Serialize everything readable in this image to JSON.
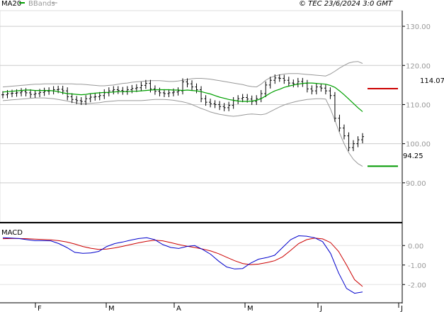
{
  "header": {
    "legend": [
      {
        "label": "MA20",
        "color": "#00a000"
      },
      {
        "label": "BBands",
        "color": "#999999"
      }
    ],
    "copyright": "© TEC 23/6/2024 3:0 GMT"
  },
  "levels": {
    "resistance": {
      "label": "114.07",
      "value": 114.07,
      "color": "#cc0000"
    },
    "support": {
      "label": "94.25",
      "value": 94.25,
      "color": "#009900"
    }
  },
  "macd_label": "MACD",
  "colors": {
    "ma20": "#00a000",
    "bbands": "#999999",
    "bars": "#000000",
    "macd": "#0000cc",
    "signal": "#cc0000",
    "grid": "#cccccc"
  },
  "chart_data": [
    {
      "type": "ohlc",
      "title": "",
      "x_ticks": [
        "F",
        "M",
        "A",
        "M",
        "J",
        "J"
      ],
      "y_ticks": [
        "130.00",
        "120.00",
        "110.00",
        "100.00",
        "90.00"
      ],
      "ylim": [
        80,
        134
      ],
      "grid": true,
      "close": [
        112.5,
        112.8,
        112.9,
        113.0,
        113.3,
        113.0,
        112.6,
        112.8,
        113.1,
        113.4,
        113.5,
        113.8,
        113.9,
        113.5,
        112.0,
        111.3,
        111.0,
        110.8,
        111.5,
        111.9,
        112.0,
        112.3,
        113.0,
        113.5,
        113.8,
        113.6,
        113.4,
        113.8,
        114.1,
        114.3,
        114.9,
        115.4,
        114.0,
        113.4,
        113.0,
        112.8,
        113.0,
        113.2,
        113.5,
        115.8,
        115.3,
        114.5,
        113.8,
        111.5,
        110.6,
        110.2,
        110.0,
        109.5,
        109.2,
        109.8,
        111.0,
        111.5,
        111.8,
        111.4,
        110.8,
        111.5,
        112.8,
        115.0,
        116.2,
        116.8,
        116.7,
        116.2,
        115.5,
        115.3,
        115.9,
        115.4,
        114.0,
        113.5,
        114.5,
        114.2,
        113.5,
        112.3,
        106.5,
        104.0,
        102.0,
        99.0,
        100.0,
        101.0,
        101.8
      ],
      "series": [
        {
          "name": "MA20",
          "values": [
            113.2,
            113.3,
            113.4,
            113.5,
            113.6,
            113.7,
            113.7,
            113.6,
            113.6,
            113.6,
            113.6,
            113.5,
            113.3,
            113.0,
            112.8,
            112.7,
            112.6,
            112.5,
            112.6,
            112.8,
            112.9,
            113.0,
            113.1,
            113.1,
            113.2,
            113.3,
            113.3,
            113.3,
            113.4,
            113.4,
            113.5,
            113.6,
            113.7,
            113.8,
            113.8,
            113.8,
            113.8,
            113.7,
            113.7,
            113.6,
            113.7,
            113.6,
            113.5,
            113.3,
            113.0,
            112.7,
            112.3,
            111.9,
            111.6,
            111.3,
            111.1,
            110.9,
            110.8,
            110.8,
            110.9,
            111.1,
            111.5,
            112.2,
            112.9,
            113.5,
            113.9,
            114.4,
            114.7,
            115.0,
            115.2,
            115.4,
            115.5,
            115.5,
            115.4,
            115.3,
            115.2,
            114.9,
            114.4,
            113.5,
            112.5,
            111.4,
            110.3,
            109.2,
            108.2
          ]
        },
        {
          "name": "Bollinger upper",
          "values": [
            114.5,
            114.6,
            114.7,
            114.8,
            114.9,
            115.0,
            115.1,
            115.2,
            115.2,
            115.3,
            115.3,
            115.3,
            115.3,
            115.3,
            115.3,
            115.3,
            115.2,
            115.2,
            115.1,
            115.0,
            114.9,
            114.8,
            114.8,
            114.9,
            115.0,
            115.2,
            115.4,
            115.5,
            115.7,
            115.8,
            115.9,
            116.0,
            116.1,
            116.1,
            116.1,
            116.0,
            115.9,
            115.9,
            116.0,
            116.2,
            116.4,
            116.6,
            116.7,
            116.7,
            116.6,
            116.5,
            116.3,
            116.1,
            115.9,
            115.7,
            115.5,
            115.3,
            115.1,
            114.8,
            114.6,
            114.5,
            115.2,
            116.2,
            116.9,
            117.3,
            117.6,
            117.8,
            117.9,
            117.9,
            117.9,
            117.8,
            117.7,
            117.6,
            117.5,
            117.4,
            117.3,
            117.8,
            118.5,
            119.3,
            120.0,
            120.6,
            120.9,
            121.0,
            120.5
          ]
        },
        {
          "name": "Bollinger lower",
          "values": [
            111.0,
            111.1,
            111.2,
            111.3,
            111.4,
            111.5,
            111.6,
            111.7,
            111.7,
            111.7,
            111.6,
            111.5,
            111.3,
            111.1,
            110.9,
            110.6,
            110.4,
            110.2,
            110.2,
            110.3,
            110.4,
            110.5,
            110.7,
            110.8,
            110.9,
            111.0,
            111.0,
            111.0,
            111.0,
            111.0,
            111.0,
            111.1,
            111.2,
            111.3,
            111.3,
            111.3,
            111.2,
            111.1,
            110.9,
            110.7,
            110.4,
            110.0,
            109.5,
            109.0,
            108.6,
            108.1,
            107.8,
            107.5,
            107.3,
            107.1,
            107.0,
            107.1,
            107.3,
            107.5,
            107.6,
            107.5,
            107.4,
            107.6,
            108.2,
            108.8,
            109.4,
            109.9,
            110.3,
            110.6,
            110.9,
            111.1,
            111.3,
            111.4,
            111.5,
            111.5,
            111.4,
            109.0,
            106.0,
            102.8,
            100.0,
            97.7,
            96.0,
            94.9,
            94.2
          ]
        }
      ]
    },
    {
      "type": "line",
      "title": "MACD",
      "x_ticks": [
        "F",
        "M",
        "A",
        "M",
        "J",
        "J"
      ],
      "y_ticks": [
        "0.00",
        "-1.00",
        "-2.00"
      ],
      "ylim": [
        -2.9,
        1.1
      ],
      "series": [
        {
          "name": "MACD",
          "color": "#0000cc",
          "values": [
            0.4,
            0.38,
            0.36,
            0.3,
            0.25,
            0.25,
            0.24,
            0.1,
            -0.1,
            -0.35,
            -0.4,
            -0.38,
            -0.3,
            -0.05,
            0.1,
            0.18,
            0.28,
            0.36,
            0.4,
            0.3,
            0.05,
            -0.1,
            -0.15,
            -0.05,
            0.0,
            -0.2,
            -0.45,
            -0.8,
            -1.1,
            -1.2,
            -1.18,
            -0.9,
            -0.7,
            -0.62,
            -0.5,
            -0.1,
            0.3,
            0.5,
            0.48,
            0.4,
            0.2,
            -0.4,
            -1.4,
            -2.2,
            -2.45,
            -2.38
          ]
        },
        {
          "name": "Signal",
          "color": "#cc0000",
          "values": [
            0.35,
            0.36,
            0.36,
            0.35,
            0.33,
            0.31,
            0.29,
            0.25,
            0.18,
            0.08,
            -0.05,
            -0.14,
            -0.2,
            -0.18,
            -0.12,
            -0.04,
            0.05,
            0.14,
            0.22,
            0.27,
            0.24,
            0.15,
            0.05,
            -0.03,
            -0.1,
            -0.18,
            -0.28,
            -0.42,
            -0.6,
            -0.78,
            -0.92,
            -0.98,
            -0.95,
            -0.88,
            -0.78,
            -0.58,
            -0.25,
            0.1,
            0.3,
            0.38,
            0.34,
            0.15,
            -0.3,
            -1.0,
            -1.75,
            -2.1
          ]
        }
      ]
    }
  ]
}
